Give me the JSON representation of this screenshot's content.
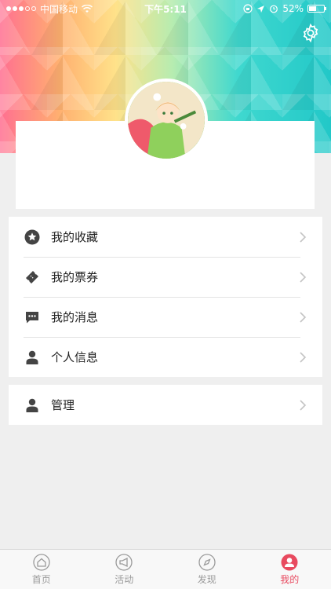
{
  "status_bar": {
    "carrier": "中国移动",
    "time": "下午5:11",
    "battery": "52%",
    "battery_level": 0.52
  },
  "header": {
    "settings_icon": "gear-icon"
  },
  "menu": {
    "group1": [
      {
        "label": "我的收藏",
        "icon": "star-circle-icon"
      },
      {
        "label": "我的票券",
        "icon": "ticket-icon"
      },
      {
        "label": "我的消息",
        "icon": "message-icon"
      },
      {
        "label": "个人信息",
        "icon": "person-icon"
      }
    ],
    "group2": [
      {
        "label": "管理",
        "icon": "person-icon"
      }
    ]
  },
  "tab_bar": {
    "tabs": [
      {
        "label": "首页",
        "icon": "home-icon",
        "active": false
      },
      {
        "label": "活动",
        "icon": "megaphone-icon",
        "active": false
      },
      {
        "label": "发现",
        "icon": "compass-icon",
        "active": false
      },
      {
        "label": "我的",
        "icon": "person-circle-icon",
        "active": true
      }
    ],
    "active_color": "#e84a5f",
    "inactive_color": "#9a9a9a"
  }
}
